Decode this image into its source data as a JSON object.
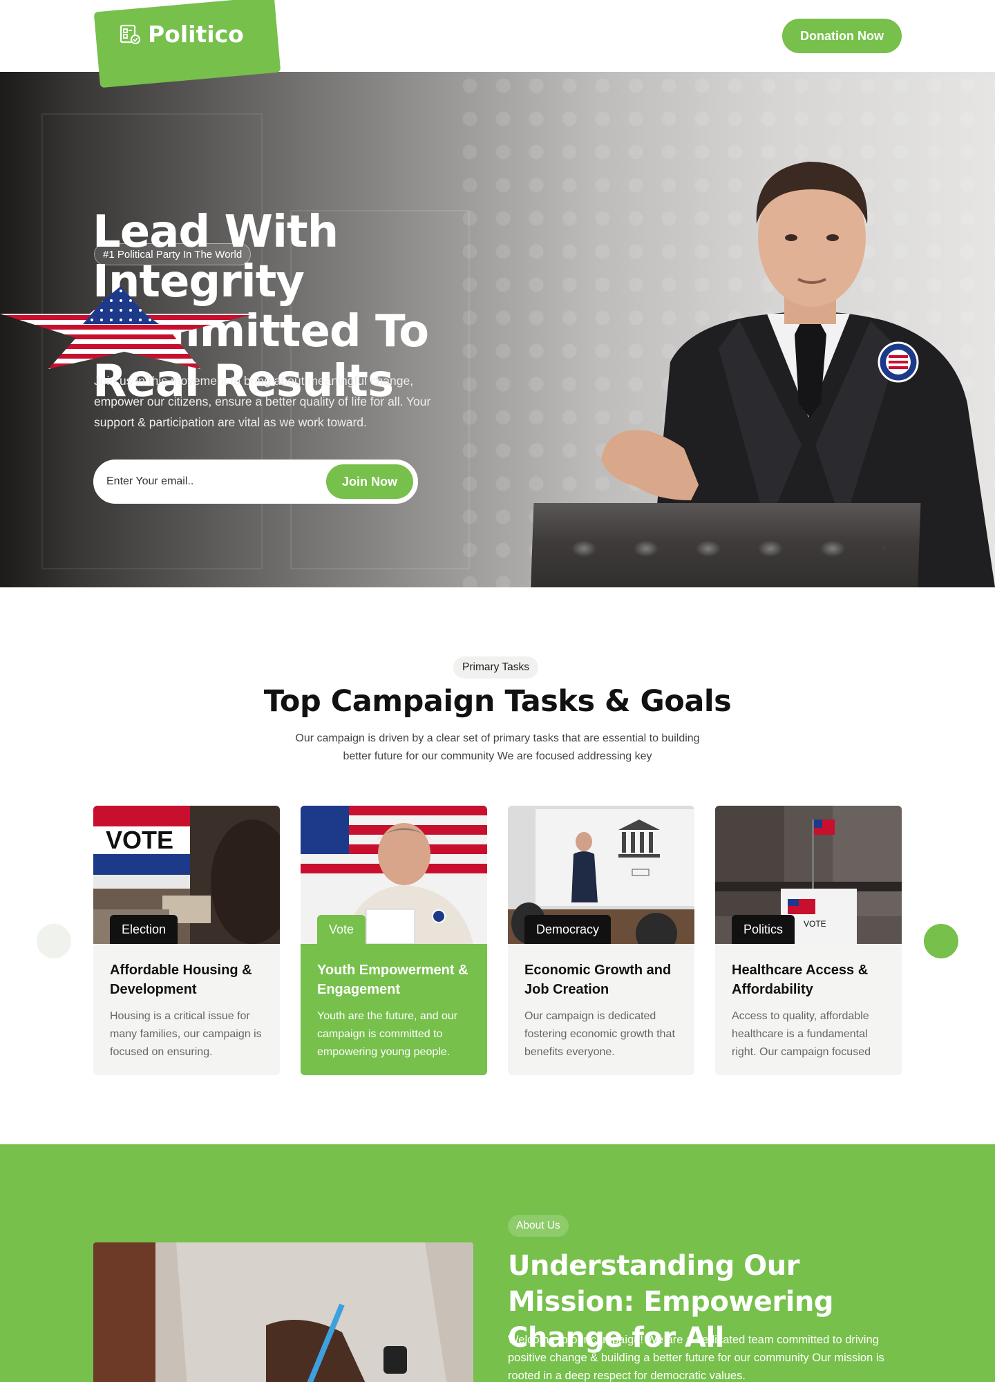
{
  "brand": {
    "name": "Politico",
    "accent": "#76c04b",
    "logo_icon": "ballot-icon"
  },
  "header": {
    "donate_label": "Donation Now"
  },
  "hero": {
    "badge": "#1 Political Party In The World",
    "title": "Lead With Integrity Committed To Real Results",
    "description": "Join us in this movement to bring about meaningful change, empower our citizens, ensure a better quality of life for all. Your support & participation are vital as we work toward.",
    "email_placeholder": "Enter Your email..",
    "join_label": "Join Now"
  },
  "tasks": {
    "badge": "Primary Tasks",
    "title": "Top Campaign Tasks & Goals",
    "description": "Our campaign is driven by a clear set of primary tasks that are essential to building  better future for our community We are focused  addressing key",
    "cards": [
      {
        "tag": "Election",
        "title": "Affordable Housing & Development",
        "text": "Housing is a critical issue for many families, our campaign is focused on ensuring."
      },
      {
        "tag": "Vote",
        "title": "Youth Empowerment & Engagement",
        "text": "Youth are the future, and our campaign is committed to empowering young people."
      },
      {
        "tag": "Democracy",
        "title": "Economic Growth and Job Creation",
        "text": "Our campaign is dedicated fostering economic growth that benefits everyone."
      },
      {
        "tag": "Politics",
        "title": "Healthcare Access & Affordability",
        "text": "Access to quality, affordable healthcare is a fundamental right. Our campaign focused"
      }
    ]
  },
  "about": {
    "badge": "About Us",
    "title": "Understanding Our Mission: Empowering Change for All",
    "text": "Welcome to our campaign! We are a dedicated team committed to driving positive change & building a better future for our community Our mission is rooted in a deep respect for democratic values."
  }
}
